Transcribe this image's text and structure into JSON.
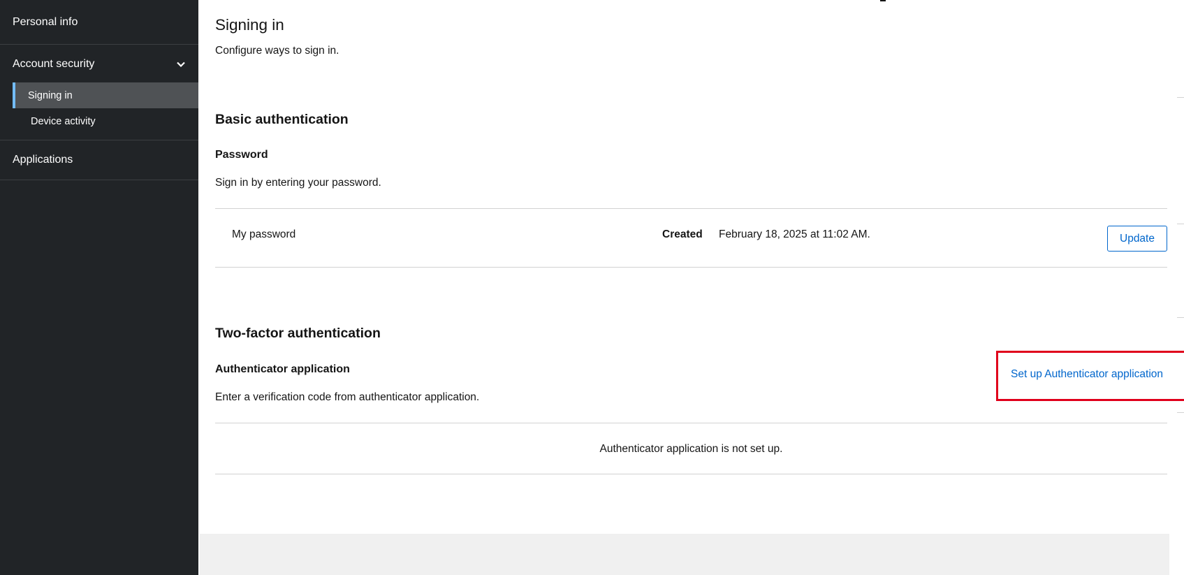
{
  "sidebar": {
    "personal_info": "Personal info",
    "account_security": "Account security",
    "chevron_icon": "chevron-down-icon",
    "sub_items": [
      {
        "label": "Signing in",
        "active": true
      },
      {
        "label": "Device activity",
        "active": false
      }
    ],
    "applications": "Applications"
  },
  "page": {
    "title": "Signing in",
    "description": "Configure ways to sign in."
  },
  "basic": {
    "title": "Basic authentication",
    "password_title": "Password",
    "password_desc": "Sign in by entering your password.",
    "row_label": "My password",
    "created_label": "Created",
    "created_value": "February 18, 2025 at 11:02 AM.",
    "update_label": "Update"
  },
  "two_factor": {
    "title": "Two-factor authentication",
    "app_title": "Authenticator application",
    "app_desc": "Enter a verification code from authenticator application.",
    "setup_link": "Set up Authenticator application",
    "empty_state": "Authenticator application is not set up."
  },
  "colors": {
    "sidebar_bg": "#212427",
    "active_item_bg": "#4f5255",
    "active_indicator": "#73bcf7",
    "link": "#0066cc",
    "highlight_box": "#e0001b"
  }
}
